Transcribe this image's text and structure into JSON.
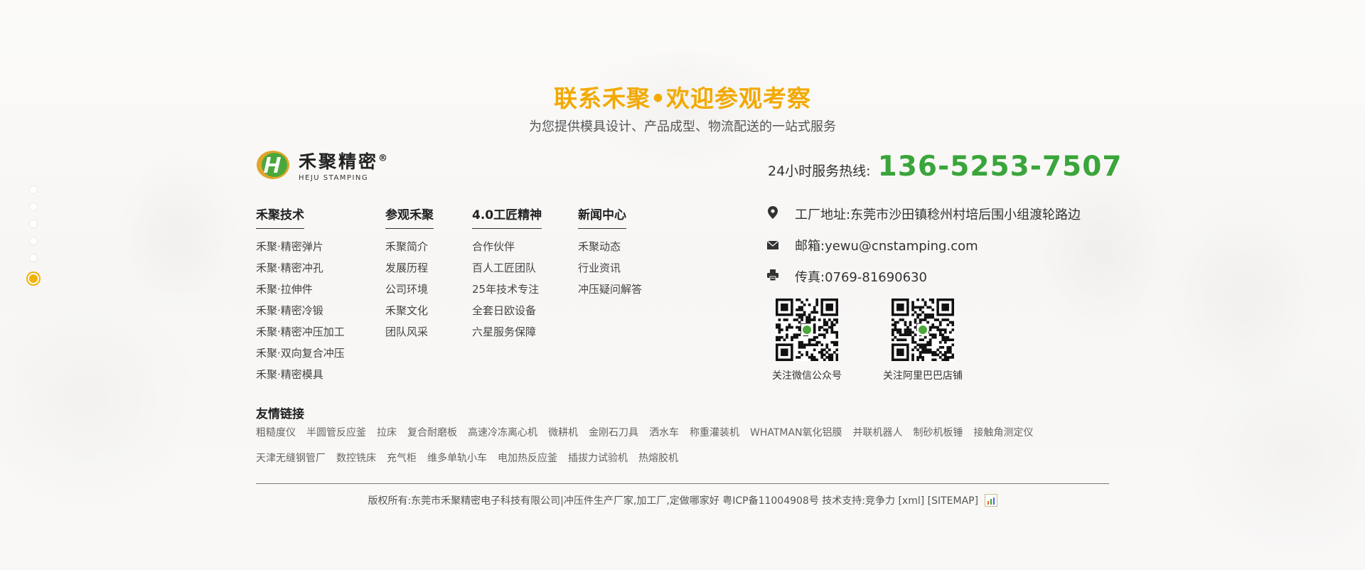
{
  "header": {
    "title": "联系禾聚•欢迎参观考察",
    "subtitle": "为您提供模具设计、产品成型、物流配送的一站式服务"
  },
  "logo": {
    "cn": "禾聚精密",
    "mark": "®",
    "en": "HEJU STAMPING"
  },
  "nav": [
    {
      "title": "禾聚技术",
      "items": [
        "禾聚·精密弹片",
        "禾聚·精密冲孔",
        "禾聚·拉伸件",
        "禾聚·精密冷锻",
        "禾聚·精密冲压加工",
        "禾聚·双向复合冲压",
        "禾聚·精密模具"
      ]
    },
    {
      "title": "参观禾聚",
      "items": [
        "禾聚简介",
        "发展历程",
        "公司环境",
        "禾聚文化",
        "团队风采"
      ]
    },
    {
      "title": "4.0工匠精神",
      "items": [
        "合作伙伴",
        "百人工匠团队",
        "25年技术专注",
        "全套日欧设备",
        "六星服务保障"
      ]
    },
    {
      "title": "新闻中心",
      "items": [
        "禾聚动态",
        "行业资讯",
        "冲压疑问解答"
      ]
    }
  ],
  "contact": {
    "hotline_label": "24小时服务热线:",
    "hotline_number": "136-5253-7507",
    "address": "工厂地址:东莞市沙田镇稔州村培后围小组渡轮路边",
    "email": "邮箱:yewu@cnstamping.com",
    "fax": "传真:0769-81690630",
    "qr_wechat_caption": "关注微信公众号",
    "qr_alibaba_caption": "关注阿里巴巴店铺"
  },
  "friend_links": {
    "title": "友情链接",
    "row1": [
      "粗糙度仪",
      "半圆管反应釜",
      "拉床",
      "复合耐磨板",
      "高速冷冻离心机",
      "微耕机",
      "金刚石刀具",
      "洒水车",
      "称重灌装机",
      "WHATMAN氧化铝膜",
      "并联机器人",
      "制砂机板锤",
      "接触角测定仪"
    ],
    "row2": [
      "天津无缝钢管厂",
      "数控铣床",
      "充气柜",
      "维多单轨小车",
      "电加热反应釜",
      "插拔力试验机",
      "热熔胶机"
    ]
  },
  "footer": {
    "copyright": "版权所有:东莞市禾聚精密电子科技有限公司|冲压件生产厂家,加工厂,定做哪家好 粤ICP备11004908号 技术支持:竞争力 [xml] [SITEMAP]"
  },
  "side_nav": {
    "count": 6,
    "active_index": 5
  },
  "colors": {
    "title": "#f2a900",
    "hotline": "#3aa53a",
    "active_dot": "#f2b100"
  },
  "icons": [
    "location-pin-icon",
    "mail-icon",
    "printer-icon",
    "qr-code-icon",
    "stats-icon"
  ]
}
